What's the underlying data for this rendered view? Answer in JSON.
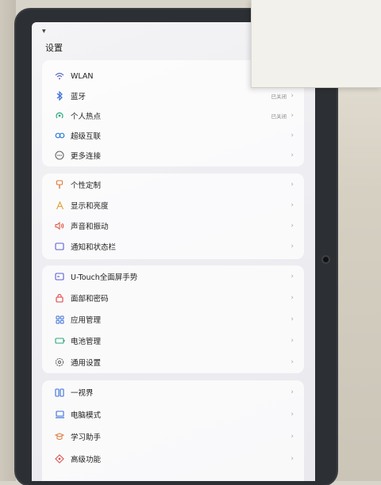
{
  "screen": {
    "title": "设置",
    "status_glyph": "▼"
  },
  "sections": [
    {
      "items": [
        {
          "label": "WLAN",
          "icon": "wifi-icon",
          "status": ""
        },
        {
          "label": "蓝牙",
          "icon": "bluetooth-icon",
          "status": "已关闭"
        },
        {
          "label": "个人热点",
          "icon": "hotspot-icon",
          "status": "已关闭"
        },
        {
          "label": "超级互联",
          "icon": "super-link-icon",
          "status": ""
        },
        {
          "label": "更多连接",
          "icon": "more-connections-icon",
          "status": ""
        }
      ]
    },
    {
      "items": [
        {
          "label": "个性定制",
          "icon": "personalization-icon"
        },
        {
          "label": "显示和亮度",
          "icon": "display-icon"
        },
        {
          "label": "声音和振动",
          "icon": "sound-icon"
        },
        {
          "label": "通知和状态栏",
          "icon": "notification-icon"
        }
      ]
    },
    {
      "items": [
        {
          "label": "U-Touch全面屏手势",
          "icon": "gesture-icon"
        },
        {
          "label": "面部和密码",
          "icon": "lock-icon"
        },
        {
          "label": "应用管理",
          "icon": "apps-icon"
        },
        {
          "label": "电池管理",
          "icon": "battery-icon"
        },
        {
          "label": "通用设置",
          "icon": "gear-icon"
        }
      ]
    },
    {
      "items": [
        {
          "label": "一视界",
          "icon": "split-view-icon"
        },
        {
          "label": "电脑模式",
          "icon": "computer-icon"
        },
        {
          "label": "学习助手",
          "icon": "study-icon"
        },
        {
          "label": "高级功能",
          "icon": "advanced-icon"
        }
      ]
    }
  ],
  "chevron": "›",
  "colors": {
    "accent": "#3b6fd8",
    "wifi": "#5b6cc8",
    "bluetooth": "#3b6fd8",
    "hotspot": "#2aa77a",
    "super_link": "#2f7fd8",
    "personalization": "#e07a3a",
    "display": "#e0a030",
    "sound": "#e0503a",
    "notification": "#5a5fd0",
    "gesture": "#5a5fd0",
    "lock": "#e04040",
    "apps": "#3b6fd8",
    "battery": "#2aa77a",
    "gear": "#666666",
    "split_view": "#3b6fd8",
    "computer": "#3b6fd8",
    "study": "#e07a3a",
    "advanced": "#e05050"
  }
}
